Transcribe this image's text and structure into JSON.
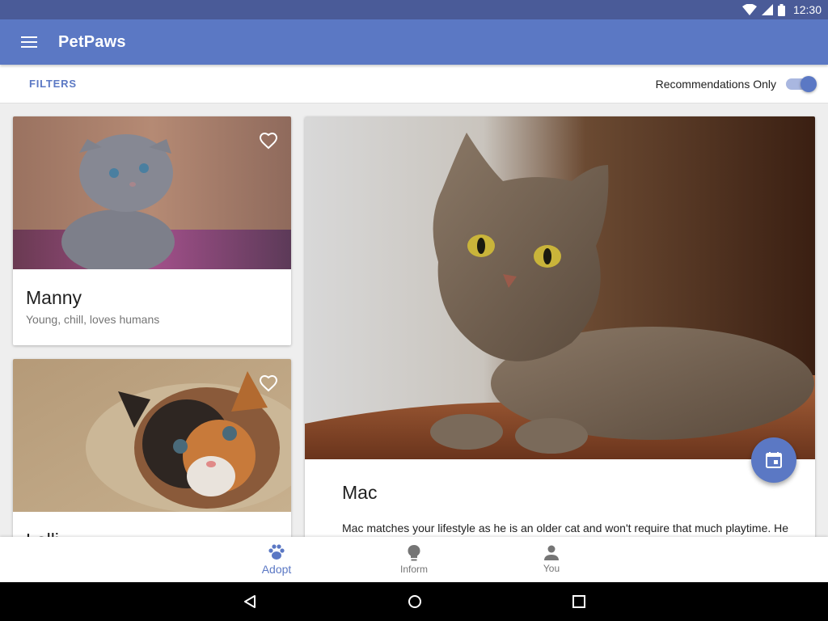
{
  "status_bar": {
    "time": "12:30"
  },
  "app_bar": {
    "title": "PetPaws",
    "menu_icon": "menu-icon"
  },
  "filter_bar": {
    "filters_label": "FILTERS",
    "recommendations_label": "Recommendations Only",
    "recommendations_on": true
  },
  "pets": [
    {
      "name": "Manny",
      "description": "Young, chill, loves humans",
      "favorite": false
    },
    {
      "name": "Lolli",
      "favorite": false
    }
  ],
  "featured": {
    "name": "Mac",
    "description": "Mac matches your lifestyle as he is an older cat and won't require that much playtime. He"
  },
  "bottom_nav": [
    {
      "label": "Adopt",
      "icon": "paw-icon",
      "active": true
    },
    {
      "label": "Inform",
      "icon": "lightbulb-icon",
      "active": false
    },
    {
      "label": "You",
      "icon": "person-icon",
      "active": false
    }
  ],
  "colors": {
    "primary": "#5b78c4",
    "status_bar": "#4a5b98",
    "accent_track": "#a9b7e0"
  }
}
